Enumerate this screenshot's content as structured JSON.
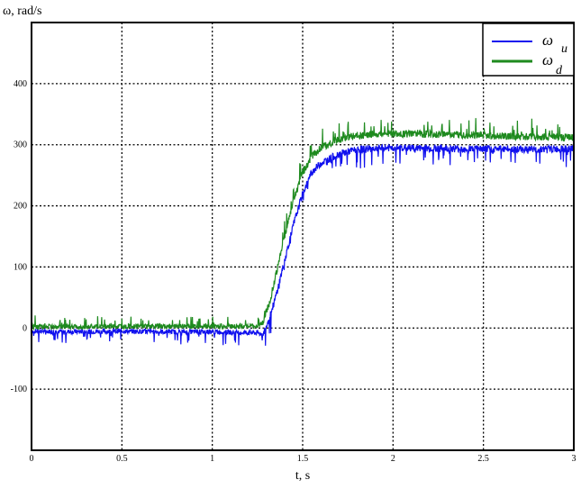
{
  "chart_data": {
    "type": "line",
    "title": "",
    "xlabel": "t, s",
    "ylabel": "ω, rad/s",
    "xlim": [
      0,
      3
    ],
    "ylim": [
      -200,
      500
    ],
    "grid": true,
    "legend_position": "top-right",
    "xticks": [
      0,
      0.5,
      1,
      1.5,
      2,
      2.5,
      3
    ],
    "xtick_labels": [
      "0",
      "0.5",
      "1",
      "1.5",
      "2",
      "2.5",
      "3"
    ],
    "yticks": [
      -100,
      0,
      100,
      200,
      300,
      400
    ],
    "ytick_labels": [
      "-100",
      "0",
      "100",
      "200",
      "300",
      "400"
    ],
    "series": [
      {
        "name": "ω_u",
        "legend_symbol": "ω",
        "legend_sub": "u",
        "color": "#1010ee",
        "x": [
          0,
          0.25,
          0.5,
          0.75,
          1.0,
          1.25,
          1.28,
          1.32,
          1.35,
          1.4,
          1.45,
          1.5,
          1.55,
          1.6,
          1.7,
          1.8,
          1.9,
          2.0,
          2.25,
          2.5,
          2.75,
          3.0
        ],
        "y": [
          -5,
          -6,
          -5,
          -6,
          -6,
          -8,
          -10,
          20,
          50,
          110,
          170,
          220,
          255,
          270,
          285,
          292,
          294,
          295,
          294,
          293,
          293,
          293
        ]
      },
      {
        "name": "ω_d",
        "legend_symbol": "ω",
        "legend_sub": "d",
        "color": "#1e8a1e",
        "x": [
          0,
          0.25,
          0.5,
          0.75,
          1.0,
          1.25,
          1.28,
          1.32,
          1.35,
          1.4,
          1.45,
          1.5,
          1.55,
          1.6,
          1.7,
          1.8,
          1.9,
          2.0,
          2.25,
          2.5,
          2.75,
          3.0
        ],
        "y": [
          2,
          2,
          3,
          3,
          3,
          3,
          10,
          45,
          85,
          150,
          210,
          255,
          280,
          295,
          308,
          315,
          317,
          318,
          317,
          315,
          313,
          312
        ]
      }
    ]
  }
}
